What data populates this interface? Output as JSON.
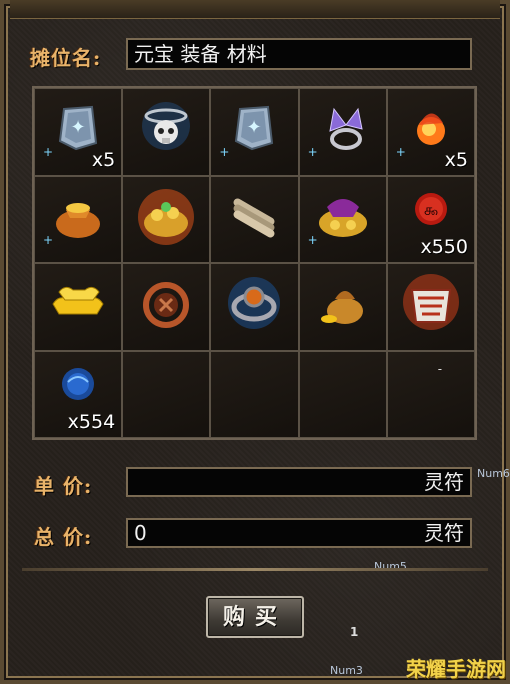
{
  "stall": {
    "name_label": "摊位名:",
    "name_value": "元宝 装备 材料"
  },
  "grid": {
    "slots": [
      {
        "item": "blue-rune-stone",
        "qty": "x5"
      },
      {
        "item": "skull-amulet",
        "qty": ""
      },
      {
        "item": "blue-rune-stone",
        "qty": ""
      },
      {
        "item": "butterfly-ring",
        "qty": ""
      },
      {
        "item": "fire-orb",
        "qty": "x5"
      },
      {
        "item": "gold-pouch",
        "qty": ""
      },
      {
        "item": "treasure-pile",
        "qty": ""
      },
      {
        "item": "scroll-bundle",
        "qty": ""
      },
      {
        "item": "gold-pouch-purple",
        "qty": ""
      },
      {
        "item": "red-rune-orb",
        "qty": "x550"
      },
      {
        "item": "gold-ingots",
        "qty": ""
      },
      {
        "item": "bronze-coin",
        "qty": ""
      },
      {
        "item": "gem-ring",
        "qty": ""
      },
      {
        "item": "gold-pouch-small",
        "qty": ""
      },
      {
        "item": "flaming-armor",
        "qty": ""
      },
      {
        "item": "blue-orb",
        "qty": "x554"
      },
      {
        "item": "",
        "qty": ""
      },
      {
        "item": "",
        "qty": ""
      },
      {
        "item": "",
        "qty": ""
      },
      {
        "item": "",
        "qty": ""
      }
    ],
    "dash_mark": "-"
  },
  "price": {
    "unit_label": "单 价:",
    "unit_value": "",
    "unit_currency": "灵符",
    "total_label": "总 价:",
    "total_value": "0",
    "total_currency": "灵符"
  },
  "buy_button": "购买",
  "hints": {
    "num6": "Num6",
    "num5": "Num5",
    "num3": "Num3",
    "one": "1"
  },
  "watermark": "荣耀手游网"
}
